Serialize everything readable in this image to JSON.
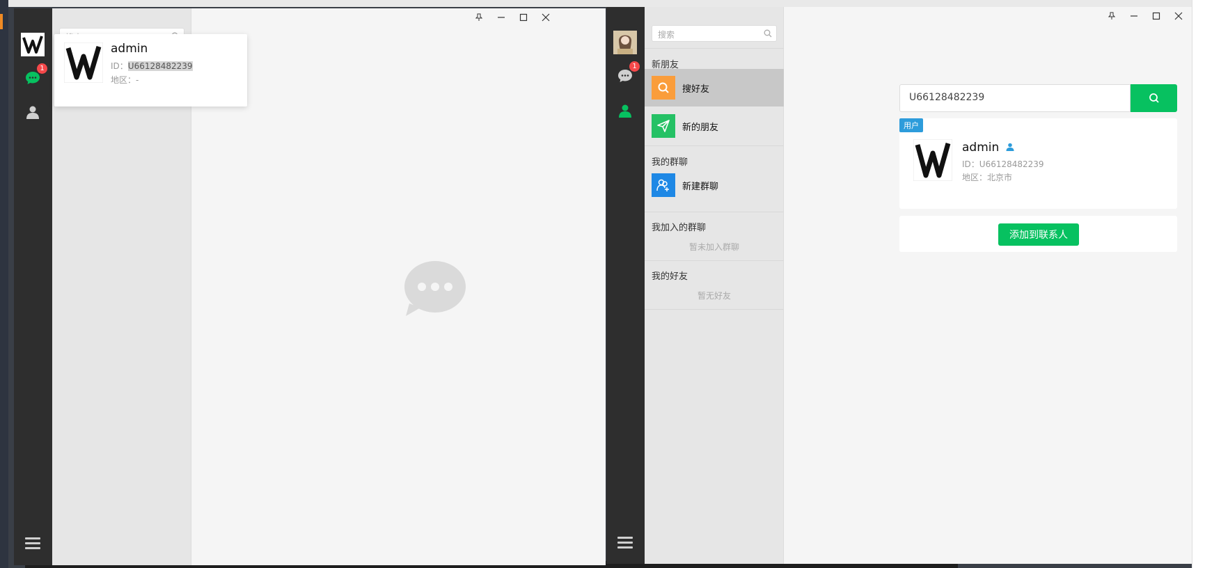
{
  "window_left": {
    "popup": {
      "name": "admin",
      "id_label": "ID：",
      "id_value": "U66128482239",
      "region_label": "地区：",
      "region_value": "-"
    },
    "badge_count": "1",
    "search_placeholder": "搜索"
  },
  "window_right": {
    "search_placeholder": "搜索",
    "badge_count": "1",
    "sections": {
      "new_friends": "新朋友",
      "search_friend": "搜好友",
      "new_friend_item": "新的朋友",
      "my_groups": "我的群聊",
      "create_group": "新建群聊",
      "joined_groups": "我加入的群聊",
      "joined_groups_empty": "暂未加入群聊",
      "my_friends": "我的好友",
      "my_friends_empty": "暂无好友"
    },
    "search_value": "U66128482239",
    "result": {
      "tag": "用户",
      "name": "admin",
      "id_text": "ID：U66128482239",
      "region_text": "地区：北京市"
    },
    "add_button": "添加到联系人"
  },
  "colors": {
    "accent_green": "#07c160",
    "badge_red": "#f5484a",
    "tag_blue": "#2d9cdb",
    "search_orange": "#fa9d3b",
    "new_friend_green": "#25c165",
    "group_blue": "#1e88e5"
  },
  "window_controls": [
    "pin-icon",
    "minimize-icon",
    "maximize-icon",
    "close-icon"
  ]
}
